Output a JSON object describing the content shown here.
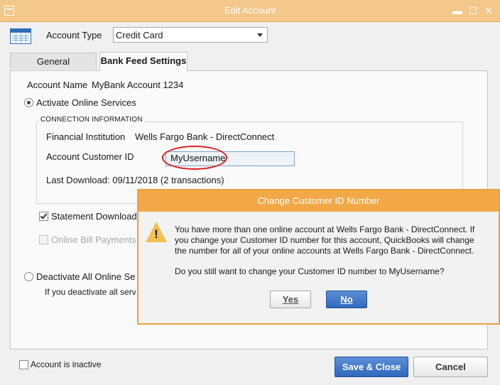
{
  "window": {
    "title": "Edit Account",
    "minimize_glyph": "▬",
    "maximize_glyph": "☐",
    "close_glyph": "✕"
  },
  "header": {
    "account_type_label": "Account Type",
    "account_type_value": "Credit Card"
  },
  "tabs": [
    {
      "label": "General"
    },
    {
      "label": "Bank Feed Settings"
    }
  ],
  "bank_feed": {
    "account_name_label": "Account Name",
    "account_name_value": "MyBank Account 1234",
    "activate_label": "Activate Online Services",
    "connection_title": "CONNECTION INFORMATION",
    "institution_label": "Financial Institution",
    "institution_value": "Wells Fargo Bank - DirectConnect",
    "customer_id_label": "Account Customer ID",
    "customer_id_value": "MyUsername",
    "last_download": "Last Download: 09/11/2018 (2 transactions)",
    "statement_downloads_label": "Statement Downloads",
    "online_bill_payments_label": "Online Bill Payments",
    "deactivate_label": "Deactivate All Online Servi",
    "deactivate_note": "If you deactivate all serv"
  },
  "footer": {
    "inactive_label": "Account is inactive",
    "save_label": "Save & Close",
    "cancel_label": "Cancel"
  },
  "dialog": {
    "title": "Change Customer ID Number",
    "icon": "warning-icon",
    "message_line1": "You have more than one online account at Wells Fargo Bank - DirectConnect.  If",
    "message_line2": "you change your Customer ID number for this account, QuickBooks will change",
    "message_line3": "the number for all of your online accounts at Wells Fargo Bank - DirectConnect.",
    "question": "Do you still want to change your Customer ID number to MyUsername?",
    "yes_label": "Yes",
    "no_label": "No"
  },
  "colors": {
    "titlebar": "#f3c88a",
    "dialog_titlebar": "#f3a847",
    "primary_button": "#2f68bd",
    "annotation": "#d62020"
  }
}
